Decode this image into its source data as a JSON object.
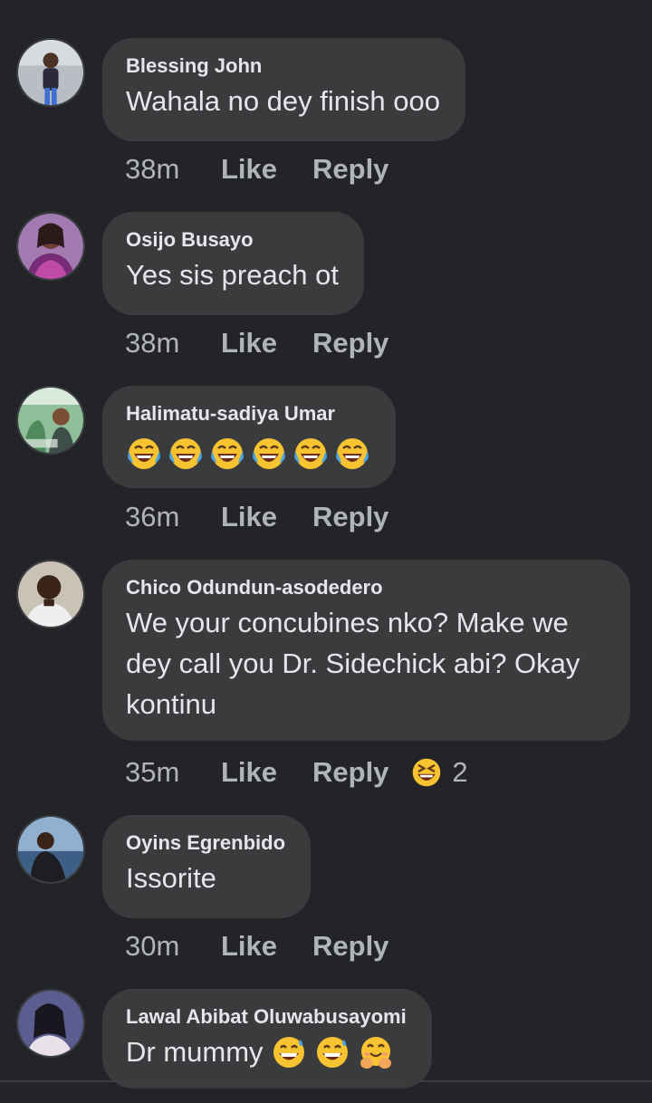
{
  "comments": [
    {
      "author": "Blessing John",
      "text": "Wahala no dey finish ooo",
      "time": "38m",
      "like": "Like",
      "reply": "Reply"
    },
    {
      "author": "Osijo Busayo",
      "text": "Yes sis preach ot",
      "time": "38m",
      "like": "Like",
      "reply": "Reply"
    },
    {
      "author": "Halimatu-sadiya Umar",
      "emojis": [
        "tears-of-joy-emoji",
        "tears-of-joy-emoji",
        "tears-of-joy-emoji",
        "tears-of-joy-emoji",
        "tears-of-joy-emoji",
        "tears-of-joy-emoji"
      ],
      "time": "36m",
      "like": "Like",
      "reply": "Reply"
    },
    {
      "author": "Chico Odundun-asodedero",
      "text": "We your concubines nko? Make we dey call you Dr. Sidechick abi? Okay kontinu",
      "time": "35m",
      "like": "Like",
      "reply": "Reply",
      "reaction": {
        "icon": "laughing-squint-emoji",
        "count": "2"
      }
    },
    {
      "author": "Oyins Egrenbido",
      "text": "Issorite",
      "time": "30m",
      "like": "Like",
      "reply": "Reply"
    },
    {
      "author": "Lawal Abibat Oluwabusayomi",
      "text": "Dr mummy",
      "emojis": [
        "grinning-sweat-emoji",
        "grinning-sweat-emoji",
        "hug-emoji"
      ]
    }
  ],
  "colors": {
    "background": "#232428",
    "bubble": "#3a3b3c",
    "text": "#e4e6eb",
    "meta": "#b0b3b8",
    "emoji_yellow": "#f7c331"
  }
}
